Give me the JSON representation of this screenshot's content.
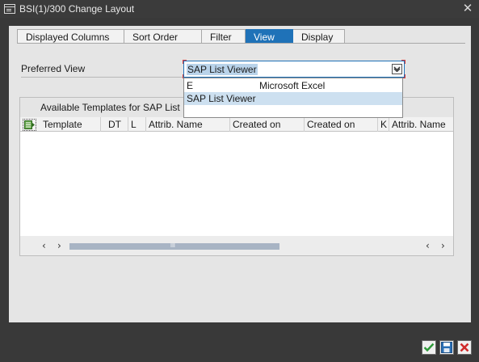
{
  "window": {
    "title": "BSI(1)/300 Change Layout",
    "close_glyph": "✕"
  },
  "tabs": [
    {
      "label": "Displayed Columns",
      "active": false
    },
    {
      "label": "Sort Order",
      "active": false
    },
    {
      "label": "Filter",
      "active": false
    },
    {
      "label": "View",
      "active": true
    },
    {
      "label": "Display",
      "active": false
    }
  ],
  "preferred_view": {
    "label": "Preferred View",
    "value": "SAP List Viewer",
    "options": [
      {
        "key": "E",
        "text": "Microsoft Excel",
        "selected": false
      },
      {
        "key": "",
        "text": "SAP List Viewer",
        "selected": true
      }
    ]
  },
  "templates": {
    "title": "Available Templates for SAP List",
    "columns": [
      "Template",
      "DT",
      "L",
      "Attrib. Name",
      "Created on",
      "Created on",
      "K",
      "Attrib. Name"
    ],
    "rows": []
  },
  "scrollbar": {
    "left_arrows": [
      "‹",
      "›"
    ],
    "right_arrows": [
      "‹",
      "›"
    ],
    "grip": "III"
  },
  "colors": {
    "active_tab": "#1f72b8",
    "selected_row": "#cde0f0",
    "confirm_green": "#2e9a3a",
    "cancel_red": "#d02b2b"
  },
  "icons": {
    "window": "window-menu-icon",
    "dropdown": "dropdown-chevron-icon",
    "grid": "column-settings-icon",
    "ok": "checkmark-icon",
    "save": "save-disk-icon",
    "cancel": "cancel-x-icon"
  }
}
